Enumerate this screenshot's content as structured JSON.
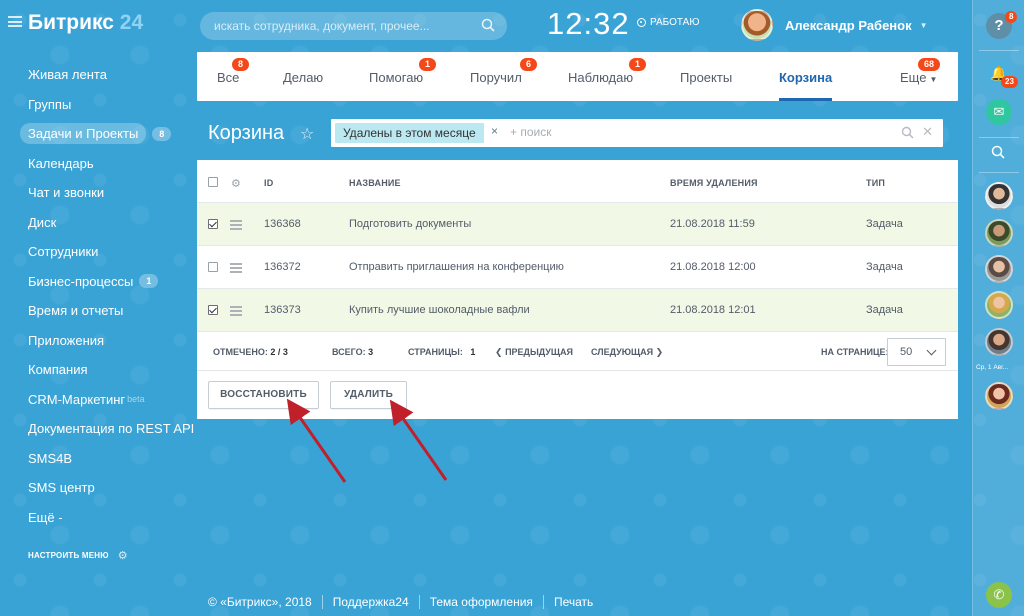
{
  "header": {
    "logo_main": "Битрикс",
    "logo_num": "24",
    "search_placeholder": "искать сотрудника, документ, прочее...",
    "clock": "12:32",
    "work_status": "РАБОТАЮ",
    "user_name": "Александр Рабенок"
  },
  "sidebar": {
    "items": [
      {
        "label": "Живая лента"
      },
      {
        "label": "Группы"
      },
      {
        "label": "Задачи и Проекты",
        "count": "8"
      },
      {
        "label": "Календарь"
      },
      {
        "label": "Чат и звонки"
      },
      {
        "label": "Диск"
      },
      {
        "label": "Сотрудники"
      },
      {
        "label": "Бизнес-процессы",
        "count": "1"
      },
      {
        "label": "Время и отчеты"
      },
      {
        "label": "Приложения"
      },
      {
        "label": "Компания"
      },
      {
        "label": "CRM-Маркетинг",
        "sup": "beta"
      },
      {
        "label": "Документация по REST API"
      },
      {
        "label": "SMS4B"
      },
      {
        "label": "SMS центр"
      },
      {
        "label": "Ещё -"
      }
    ],
    "setup": "НАСТРОИТЬ МЕНЮ"
  },
  "tabs": [
    {
      "label": "Все",
      "badge": "8"
    },
    {
      "label": "Делаю"
    },
    {
      "label": "Помогаю",
      "badge": "1"
    },
    {
      "label": "Поручил",
      "badge": "6"
    },
    {
      "label": "Наблюдаю",
      "badge": "1"
    },
    {
      "label": "Проекты"
    },
    {
      "label": "Корзина",
      "active": true
    },
    {
      "label": "Еще",
      "badge": "68"
    }
  ],
  "page": {
    "title": "Корзина",
    "filter_tag": "Удалены в этом месяце",
    "filter_placeholder": "+ поиск"
  },
  "grid": {
    "columns": [
      "ID",
      "НАЗВАНИЕ",
      "ВРЕМЯ УДАЛЕНИЯ",
      "ТИП"
    ],
    "rows": [
      {
        "id": "136368",
        "name": "Подготовить документы",
        "time": "21.08.2018 11:59",
        "type": "Задача",
        "checked": true
      },
      {
        "id": "136372",
        "name": "Отправить приглашения на конференцию",
        "time": "21.08.2018 12:00",
        "type": "Задача",
        "checked": false
      },
      {
        "id": "136373",
        "name": "Купить лучшие шоколадные вафли",
        "time": "21.08.2018 12:01",
        "type": "Задача",
        "checked": true
      }
    ],
    "footer": {
      "checked_label": "ОТМЕЧЕНО:",
      "checked_value": "2 / 3",
      "total_label": "ВСЕГО:",
      "total_value": "3",
      "pages_label": "СТРАНИЦЫ:",
      "pages_value": "1",
      "prev": "ПРЕДЫДУЩАЯ",
      "next": "СЛЕДУЮЩАЯ",
      "per_page_label": "НА СТРАНИЦЕ:",
      "per_page_value": "50"
    },
    "buttons": {
      "restore": "ВОССТАНОВИТЬ",
      "delete": "УДАЛИТЬ"
    }
  },
  "rightbar": {
    "help_badge": "8",
    "notif_badge": "23",
    "note": "Ср, 1 Авг..."
  },
  "footer": {
    "copyright": "© «Битрикс», 2018",
    "support": "Поддержка24",
    "theme": "Тема оформления",
    "print": "Печать"
  },
  "colors": {
    "background": "#3aa3d6",
    "badge": "#f54819",
    "accent": "#2067b0",
    "checked_row": "#f1f8e5",
    "arrow": "#c0202a"
  }
}
